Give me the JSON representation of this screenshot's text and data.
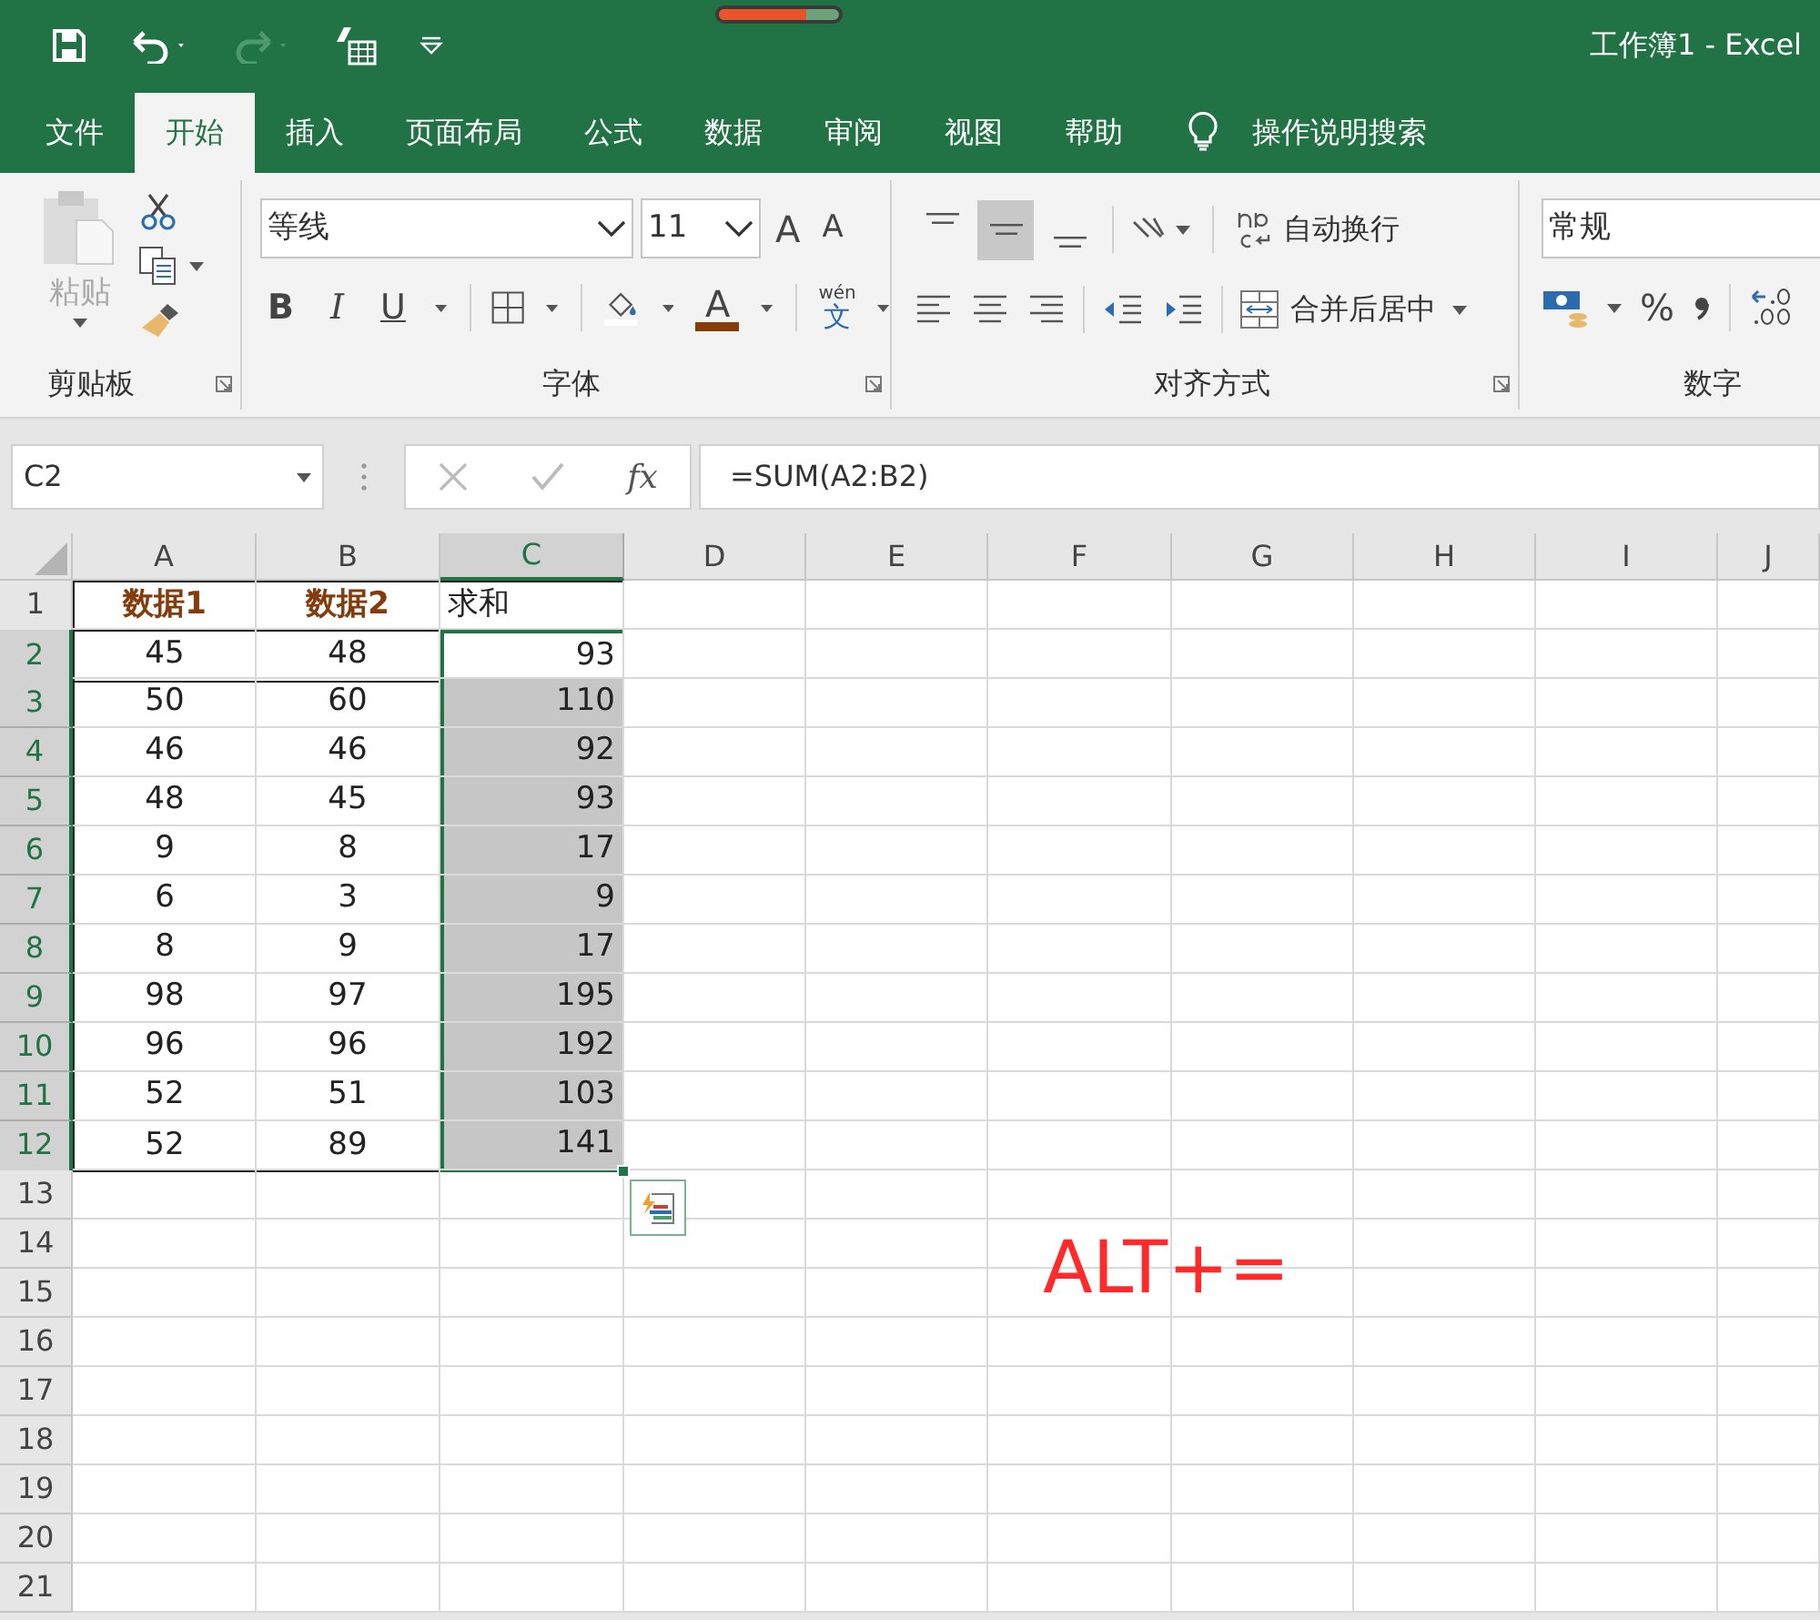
{
  "window": {
    "title": "工作簿1 - Excel",
    "indicator": {
      "level": 0.72
    }
  },
  "tabs": [
    {
      "label": "文件",
      "selected": false
    },
    {
      "label": "开始",
      "selected": true
    },
    {
      "label": "插入",
      "selected": false
    },
    {
      "label": "页面布局",
      "selected": false
    },
    {
      "label": "公式",
      "selected": false
    },
    {
      "label": "数据",
      "selected": false
    },
    {
      "label": "审阅",
      "selected": false
    },
    {
      "label": "视图",
      "selected": false
    },
    {
      "label": "帮助",
      "selected": false
    }
  ],
  "tell_me": {
    "placeholder": "操作说明搜索"
  },
  "ribbon": {
    "clipboard": {
      "label": "剪贴板",
      "paste": "粘贴"
    },
    "font": {
      "label": "字体",
      "font_name": "等线",
      "font_size": "11",
      "grow": "A",
      "shrink": "A",
      "styles": [
        "B",
        "I",
        "U"
      ],
      "font_color": "A",
      "phonetic_top": "wén",
      "phonetic_char": "文"
    },
    "alignment": {
      "label": "对齐方式",
      "vertical": [
        {
          "selected": false
        },
        {
          "selected": true
        },
        {
          "selected": false
        }
      ],
      "wrap_text": "自动换行",
      "merge": "合并后居中"
    },
    "number": {
      "label": "数字",
      "format": "常规",
      "percent": "%"
    }
  },
  "formula_bar": {
    "name_box": "C2",
    "fx": "fx",
    "formula": "=SUM(A2:B2)"
  },
  "sheet": {
    "columns": [
      {
        "label": "A",
        "selected": false
      },
      {
        "label": "B",
        "selected": false
      },
      {
        "label": "C",
        "selected": true
      },
      {
        "label": "D",
        "selected": false
      },
      {
        "label": "E",
        "selected": false
      },
      {
        "label": "F",
        "selected": false
      },
      {
        "label": "G",
        "selected": false
      },
      {
        "label": "H",
        "selected": false
      },
      {
        "label": "I",
        "selected": false
      },
      {
        "label": "J",
        "selected": false
      }
    ],
    "rows": [
      {
        "number": "1",
        "cells": [
          "数据1",
          "数据2",
          "求和"
        ],
        "kind": "header",
        "selected": false,
        "active": false
      },
      {
        "number": "2",
        "cells": [
          "45",
          "48",
          "93"
        ],
        "kind": "data",
        "selected": true,
        "active": true
      },
      {
        "number": "3",
        "cells": [
          "50",
          "60",
          "110"
        ],
        "kind": "data",
        "selected": true,
        "active": false
      },
      {
        "number": "4",
        "cells": [
          "46",
          "46",
          "92"
        ],
        "kind": "data",
        "selected": true,
        "active": false
      },
      {
        "number": "5",
        "cells": [
          "48",
          "45",
          "93"
        ],
        "kind": "data",
        "selected": true,
        "active": false
      },
      {
        "number": "6",
        "cells": [
          "9",
          "8",
          "17"
        ],
        "kind": "data",
        "selected": true,
        "active": false
      },
      {
        "number": "7",
        "cells": [
          "6",
          "3",
          "9"
        ],
        "kind": "data",
        "selected": true,
        "active": false
      },
      {
        "number": "8",
        "cells": [
          "8",
          "9",
          "17"
        ],
        "kind": "data",
        "selected": true,
        "active": false
      },
      {
        "number": "9",
        "cells": [
          "98",
          "97",
          "195"
        ],
        "kind": "data",
        "selected": true,
        "active": false
      },
      {
        "number": "10",
        "cells": [
          "96",
          "96",
          "192"
        ],
        "kind": "data",
        "selected": true,
        "active": false
      },
      {
        "number": "11",
        "cells": [
          "52",
          "51",
          "103"
        ],
        "kind": "data",
        "selected": true,
        "active": false
      },
      {
        "number": "12",
        "cells": [
          "52",
          "89",
          "141"
        ],
        "kind": "data",
        "selected": true,
        "active": false
      },
      {
        "number": "13",
        "kind": "empty",
        "selected": false,
        "active": false
      },
      {
        "number": "14",
        "kind": "empty",
        "selected": false,
        "active": false
      },
      {
        "number": "15",
        "kind": "empty",
        "selected": false,
        "active": false
      },
      {
        "number": "16",
        "kind": "empty",
        "selected": false,
        "active": false
      },
      {
        "number": "17",
        "kind": "empty",
        "selected": false,
        "active": false
      },
      {
        "number": "18",
        "kind": "empty",
        "selected": false,
        "active": false
      },
      {
        "number": "19",
        "kind": "empty",
        "selected": false,
        "active": false
      },
      {
        "number": "20",
        "kind": "empty",
        "selected": false,
        "active": false
      },
      {
        "number": "21",
        "kind": "empty",
        "selected": false,
        "active": false
      }
    ],
    "annotation": "ALT+="
  }
}
